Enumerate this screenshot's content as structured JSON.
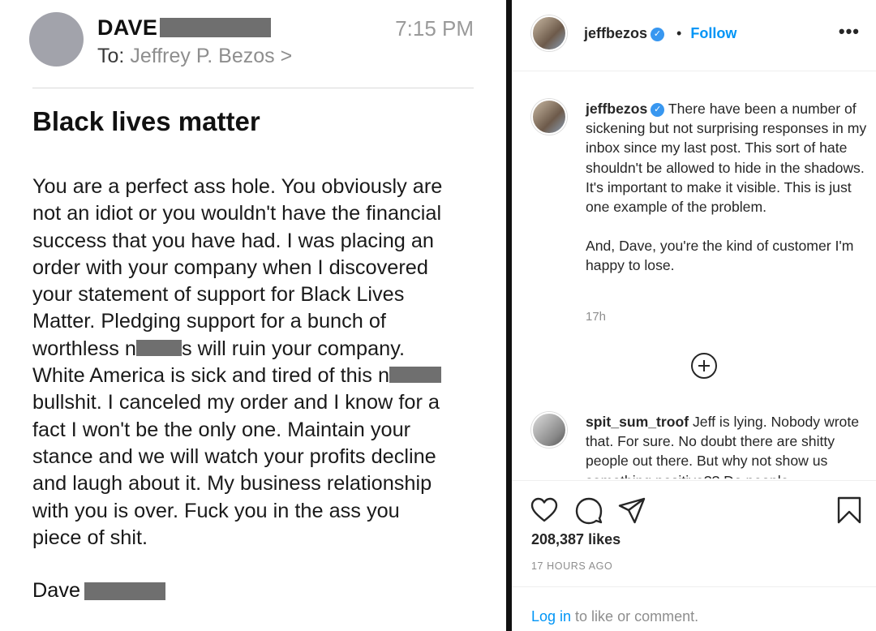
{
  "email": {
    "sender": "DAVE",
    "time": "7:15 PM",
    "to_label": "To:",
    "to_value": "Jeffrey P. Bezos",
    "to_chevron": ">",
    "subject": "Black lives matter",
    "body_lines": {
      "l1": "You are a perfect ass hole. You obviously are",
      "l2": "not an idiot or you wouldn't have the financial",
      "l3": "success that you have had. I was placing an",
      "l4": "order with your company when I discovered",
      "l5": "your statement of support for Black Lives",
      "l6": "Matter. Pledging support for a bunch of",
      "l7a": "worthless n",
      "l7b": "s will ruin your company.",
      "l8": "White America is sick and tired of this n",
      "l9": "bullshit. I canceled my order and I know for a",
      "l10": "fact I won't be the only one. Maintain your",
      "l11": "stance and we will watch your profits decline",
      "l12": "and laugh about it. My business relationship",
      "l13": "with you is over. Fuck you in the ass you",
      "l14": "piece of shit."
    },
    "signoff": "Dave"
  },
  "instagram": {
    "username": "jeffbezos",
    "verified_icon": "verified-badge-icon",
    "follow_dot": "•",
    "follow": "Follow",
    "more": "•••",
    "caption_user": "jeffbezos",
    "caption_p1": "There have been a number of sickening but not surprising responses in my inbox since my last post. This sort of hate shouldn't be allowed to hide in the shadows. It's important to make it visible. This is just one example of the problem.",
    "caption_p2": "And, Dave, you're the kind of customer I'm happy to lose.",
    "time_ago": "17h",
    "comment_user": "spit_sum_troof",
    "comment_text": "Jeff is lying. Nobody wrote that. For sure. No doubt there are shitty people out there. But why not show us something positive?? Do people",
    "likes": "208,387 likes",
    "timestamp": "17 HOURS AGO",
    "login_link": "Log in",
    "login_rest": " to like or comment."
  }
}
